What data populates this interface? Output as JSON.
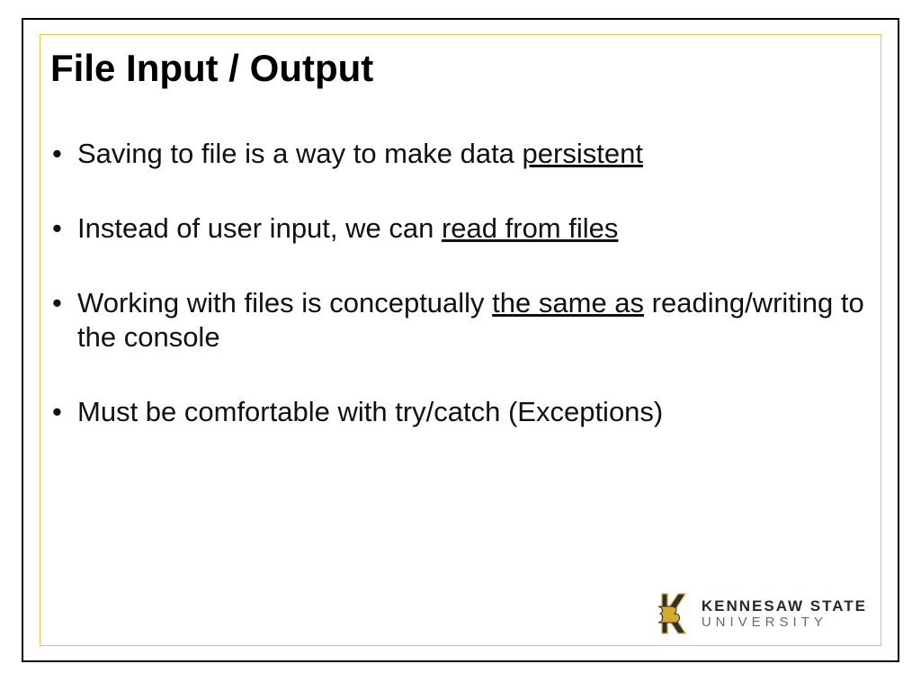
{
  "slide": {
    "title": "File Input / Output",
    "bullets": [
      {
        "pre": "Saving to file is a way to make data ",
        "u": "persistent",
        "post": ""
      },
      {
        "pre": "Instead of user input, we can ",
        "u": "read from files",
        "post": ""
      },
      {
        "pre": "Working with files is conceptually ",
        "u": "the same as",
        "post": " reading/writing to the console"
      },
      {
        "pre": "Must be comfortable with try/catch (Exceptions)",
        "u": "",
        "post": ""
      }
    ]
  },
  "logo": {
    "line1": "KENNESAW STATE",
    "line2": "UNIVERSITY"
  }
}
